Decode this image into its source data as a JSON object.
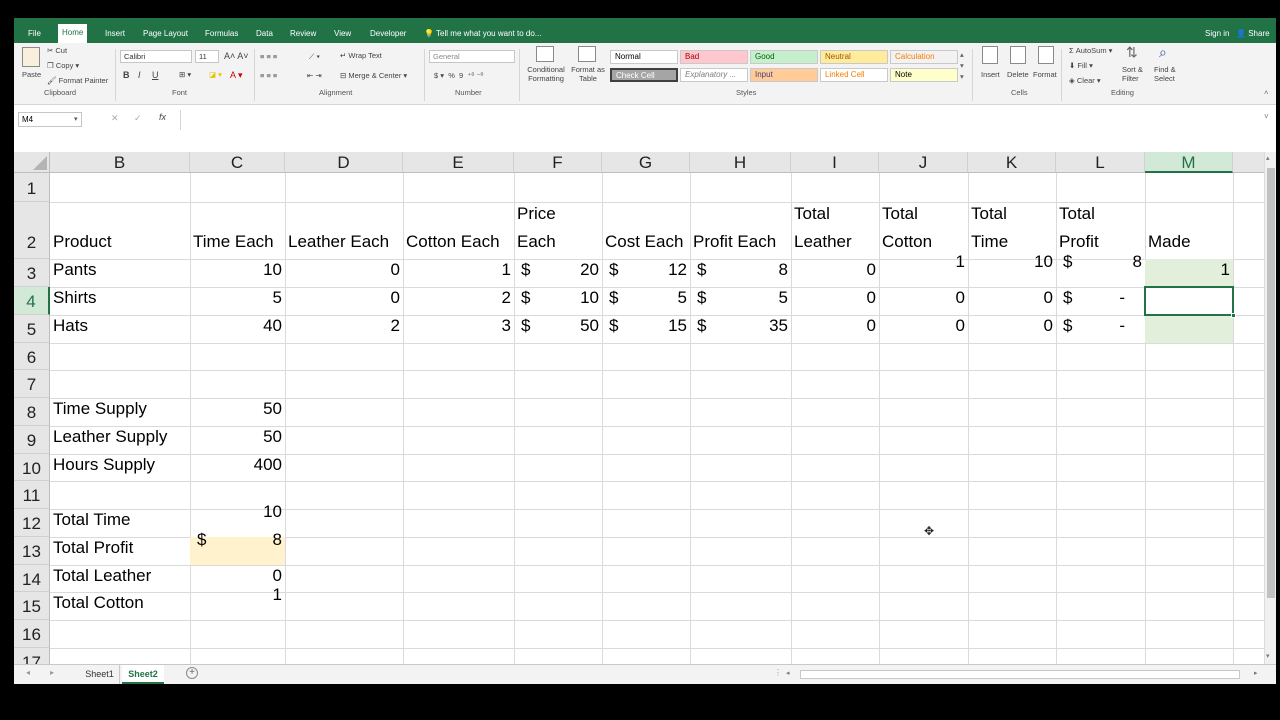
{
  "ribbon": {
    "tabs": [
      "File",
      "Home",
      "Insert",
      "Page Layout",
      "Formulas",
      "Data",
      "Review",
      "View",
      "Developer"
    ],
    "tell_me": "Tell me what you want to do...",
    "sign_in": "Sign in",
    "share": "Share",
    "clipboard": {
      "paste": "Paste",
      "cut": "Cut",
      "copy": "Copy",
      "format_painter": "Format Painter",
      "label": "Clipboard"
    },
    "font": {
      "name": "Calibri",
      "size": "11",
      "bold": "B",
      "italic": "I",
      "underline": "U",
      "label": "Font"
    },
    "alignment": {
      "wrap_text": "Wrap Text",
      "merge_center": "Merge & Center",
      "label": "Alignment"
    },
    "number": {
      "format": "General",
      "currency": "$",
      "percent": "%",
      "comma": "9",
      "label": "Number"
    },
    "styles": {
      "conditional_formatting": "Conditional Formatting",
      "format_as_table": "Format as Table",
      "cells": [
        "Normal",
        "Bad",
        "Good",
        "Neutral",
        "Calculation",
        "Check Cell",
        "Explanatory ...",
        "Input",
        "Linked Cell",
        "Note"
      ],
      "label": "Styles"
    },
    "cells_group": {
      "insert": "Insert",
      "delete": "Delete",
      "format": "Format",
      "label": "Cells"
    },
    "editing": {
      "autosum": "AutoSum",
      "fill": "Fill",
      "clear": "Clear",
      "sort_filter": "Sort & Filter",
      "find_select": "Find & Select",
      "label": "Editing"
    }
  },
  "formula_bar": {
    "name_box": "M4",
    "fx": "fx",
    "value": ""
  },
  "columns": [
    "B",
    "C",
    "D",
    "E",
    "F",
    "G",
    "H",
    "I",
    "J",
    "K",
    "L",
    "M"
  ],
  "rows": [
    "1",
    "2",
    "3",
    "4",
    "5",
    "6",
    "7",
    "8",
    "9",
    "10",
    "11",
    "12",
    "13",
    "14",
    "15",
    "16",
    "17"
  ],
  "cells": {
    "B2": "Product",
    "C2": "Time Each",
    "D2": "Leather Each",
    "E2": "Cotton Each",
    "F2a": "Price",
    "F2b": "Each",
    "G2": "Cost Each",
    "H2": "Profit Each",
    "I2a": "Total",
    "I2b": "Leather",
    "J2a": "Total",
    "J2b": "Cotton",
    "K2a": "Total",
    "K2b": "Time",
    "L2a": "Total",
    "L2b": "Profit",
    "M2": "Made",
    "B3": "Pants",
    "C3": "10",
    "D3": "0",
    "E3": "1",
    "F3": "20",
    "G3": "12",
    "H3": "8",
    "I3": "0",
    "J3": "1",
    "K3": "10",
    "L3": "8",
    "M3": "1",
    "B4": "Shirts",
    "C4": "5",
    "D4": "0",
    "E4": "2",
    "F4": "10",
    "G4": "5",
    "H4": "5",
    "I4": "0",
    "J4": "0",
    "K4": "0",
    "L4": "-",
    "B5": "Hats",
    "C5": "40",
    "D5": "2",
    "E5": "3",
    "F5": "50",
    "G5": "15",
    "H5": "35",
    "I5": "0",
    "J5": "0",
    "K5": "0",
    "L5": "-",
    "B8": "Time Supply",
    "C8": "50",
    "B9": "Leather Supply",
    "C9": "50",
    "B10": "Hours Supply",
    "C10": "400",
    "B12": "Total Time",
    "C12": "10",
    "B13": "Total Profit",
    "C13": "8",
    "B14": "Total Leather",
    "C14": "0",
    "B15": "Total Cotton",
    "C15": "1",
    "currency": "$"
  },
  "sheets": [
    "Sheet1",
    "Sheet2"
  ],
  "active_sheet": "Sheet2",
  "colors": {
    "accent": "#217346",
    "selected": "#d3e9d8",
    "highlight": "#fff2cc"
  }
}
